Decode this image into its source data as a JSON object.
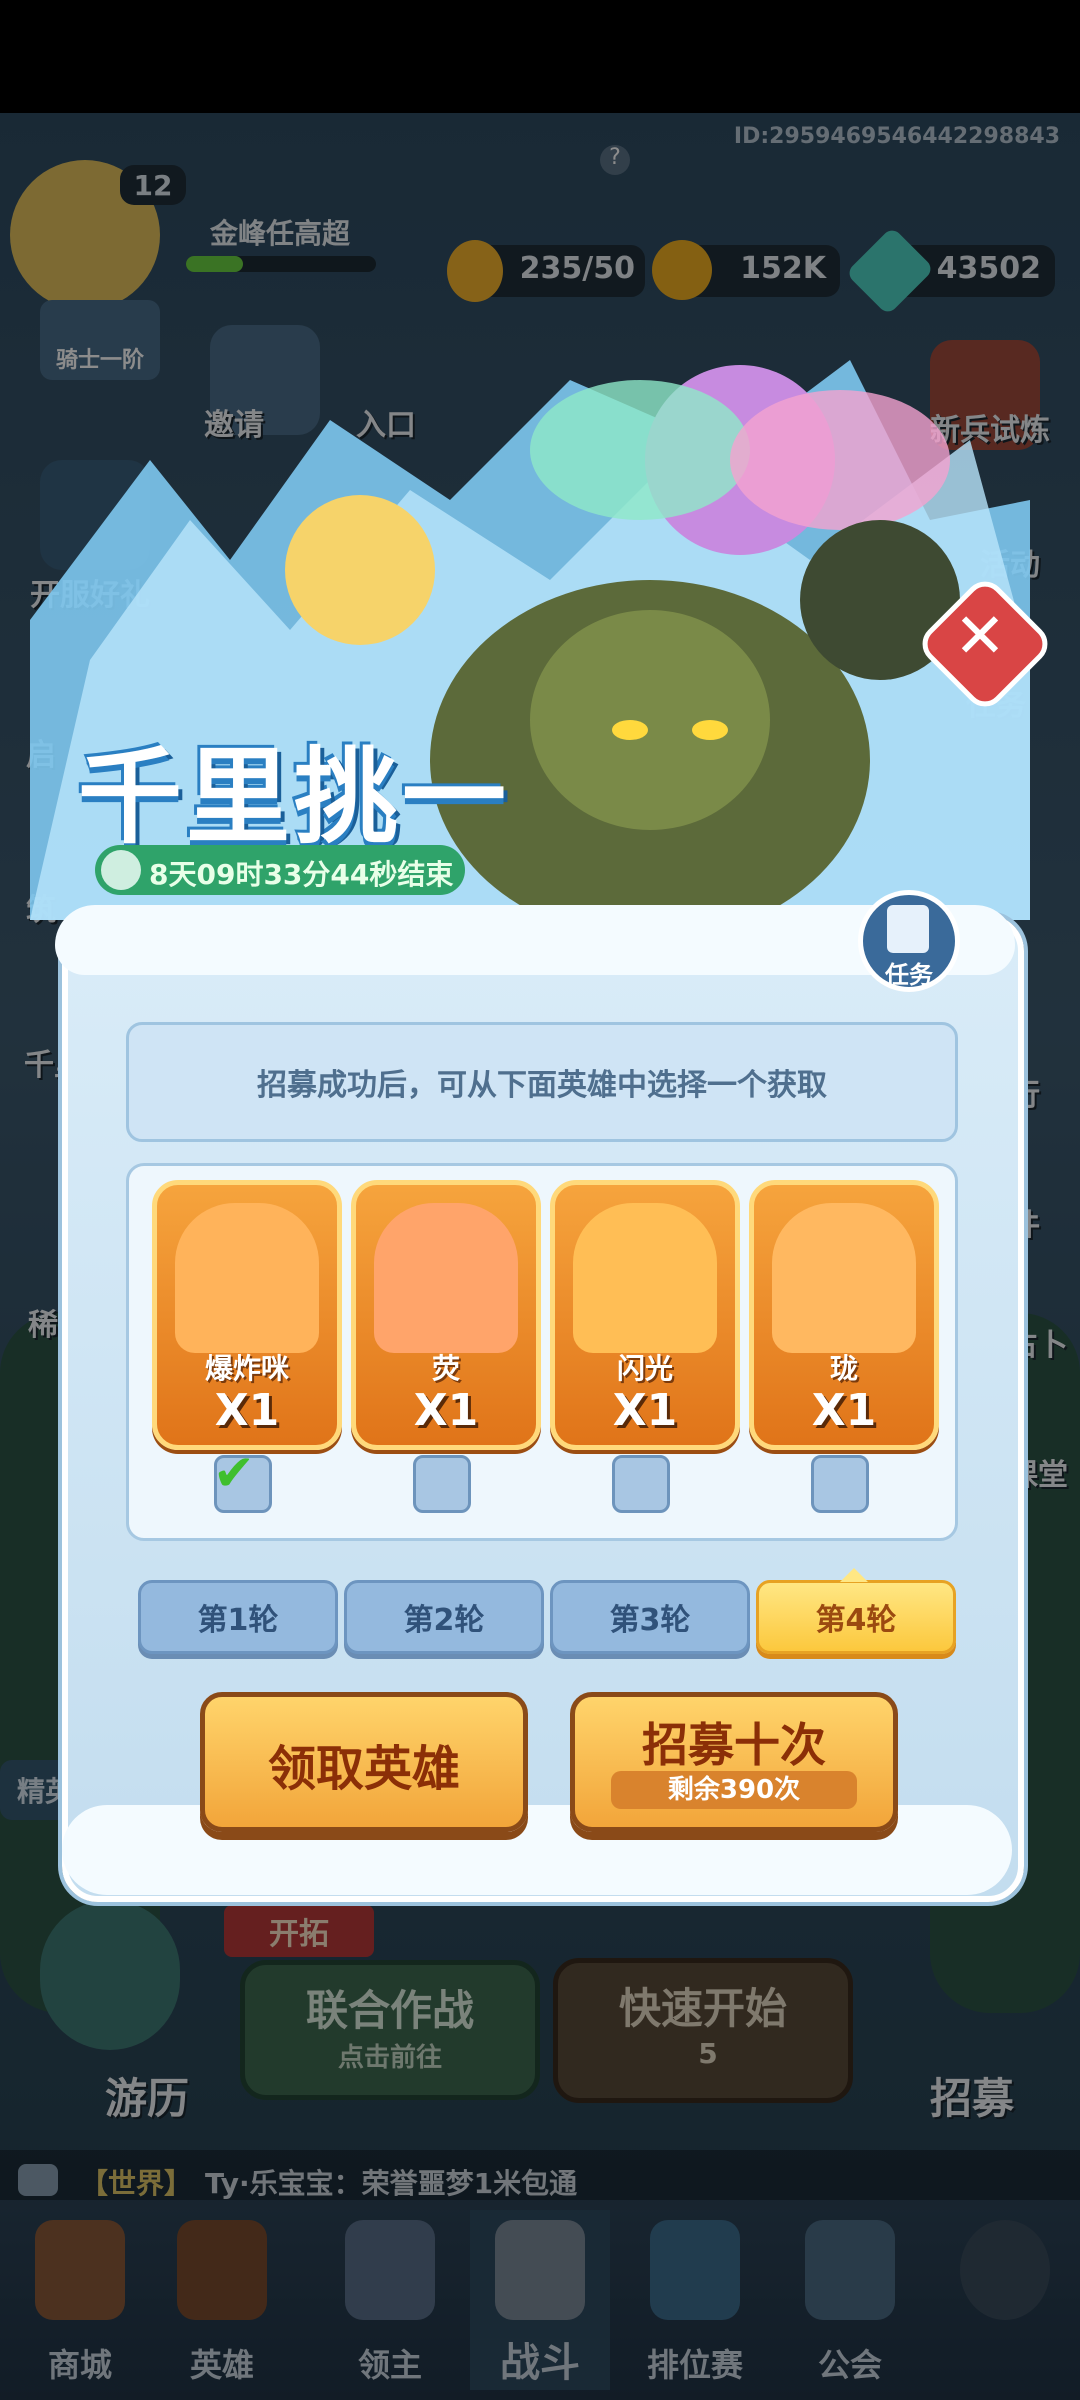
{
  "hud": {
    "id_text": "ID:2959469546442298843",
    "level": "12",
    "player_name": "金峰任高超",
    "rank_label": "骑士一阶",
    "stamina": "235/50",
    "gold": "152K",
    "gems": "43502"
  },
  "left_side": [
    "邀请",
    "入口",
    "开服好礼",
    "启",
    "筑",
    "千里",
    "稀"
  ],
  "right_side": [
    "新兵试炼",
    "活动",
    "任务",
    "行",
    "件",
    "占卜",
    "课堂"
  ],
  "popup": {
    "title": "千里挑一",
    "timer": "8天09时33分44秒结束",
    "task_label": "任务",
    "notice": "招募成功后，可从下面英雄中选择一个获取",
    "heroes": [
      {
        "name": "爆炸咪",
        "count": "X1",
        "selected": true,
        "color": "#ffb35a"
      },
      {
        "name": "荧",
        "count": "X1",
        "selected": false,
        "color": "#ffa46a"
      },
      {
        "name": "闪光",
        "count": "X1",
        "selected": false,
        "color": "#ffbe55"
      },
      {
        "name": "珑",
        "count": "X1",
        "selected": false,
        "color": "#ffb860"
      }
    ],
    "rounds": [
      "第1轮",
      "第2轮",
      "第3轮",
      "第4轮"
    ],
    "active_round_index": 3,
    "claim_button": "领取英雄",
    "recruit_button": "招募十次",
    "recruit_remaining": "剩余390次"
  },
  "lower_scene": {
    "tag_explore": "开拓",
    "coop_title": "联合作战",
    "coop_sub": "点击前往",
    "quick_start": "快速开始",
    "quick_cost": "5",
    "journey": "游历",
    "recruit": "招募",
    "elite": "精英"
  },
  "chat": {
    "channel": "【世界】",
    "message": "Ty·乐宝宝：荣誉噩梦1米包通"
  },
  "nav": [
    "商城",
    "英雄",
    "领主",
    "战斗",
    "排位赛",
    "公会"
  ]
}
